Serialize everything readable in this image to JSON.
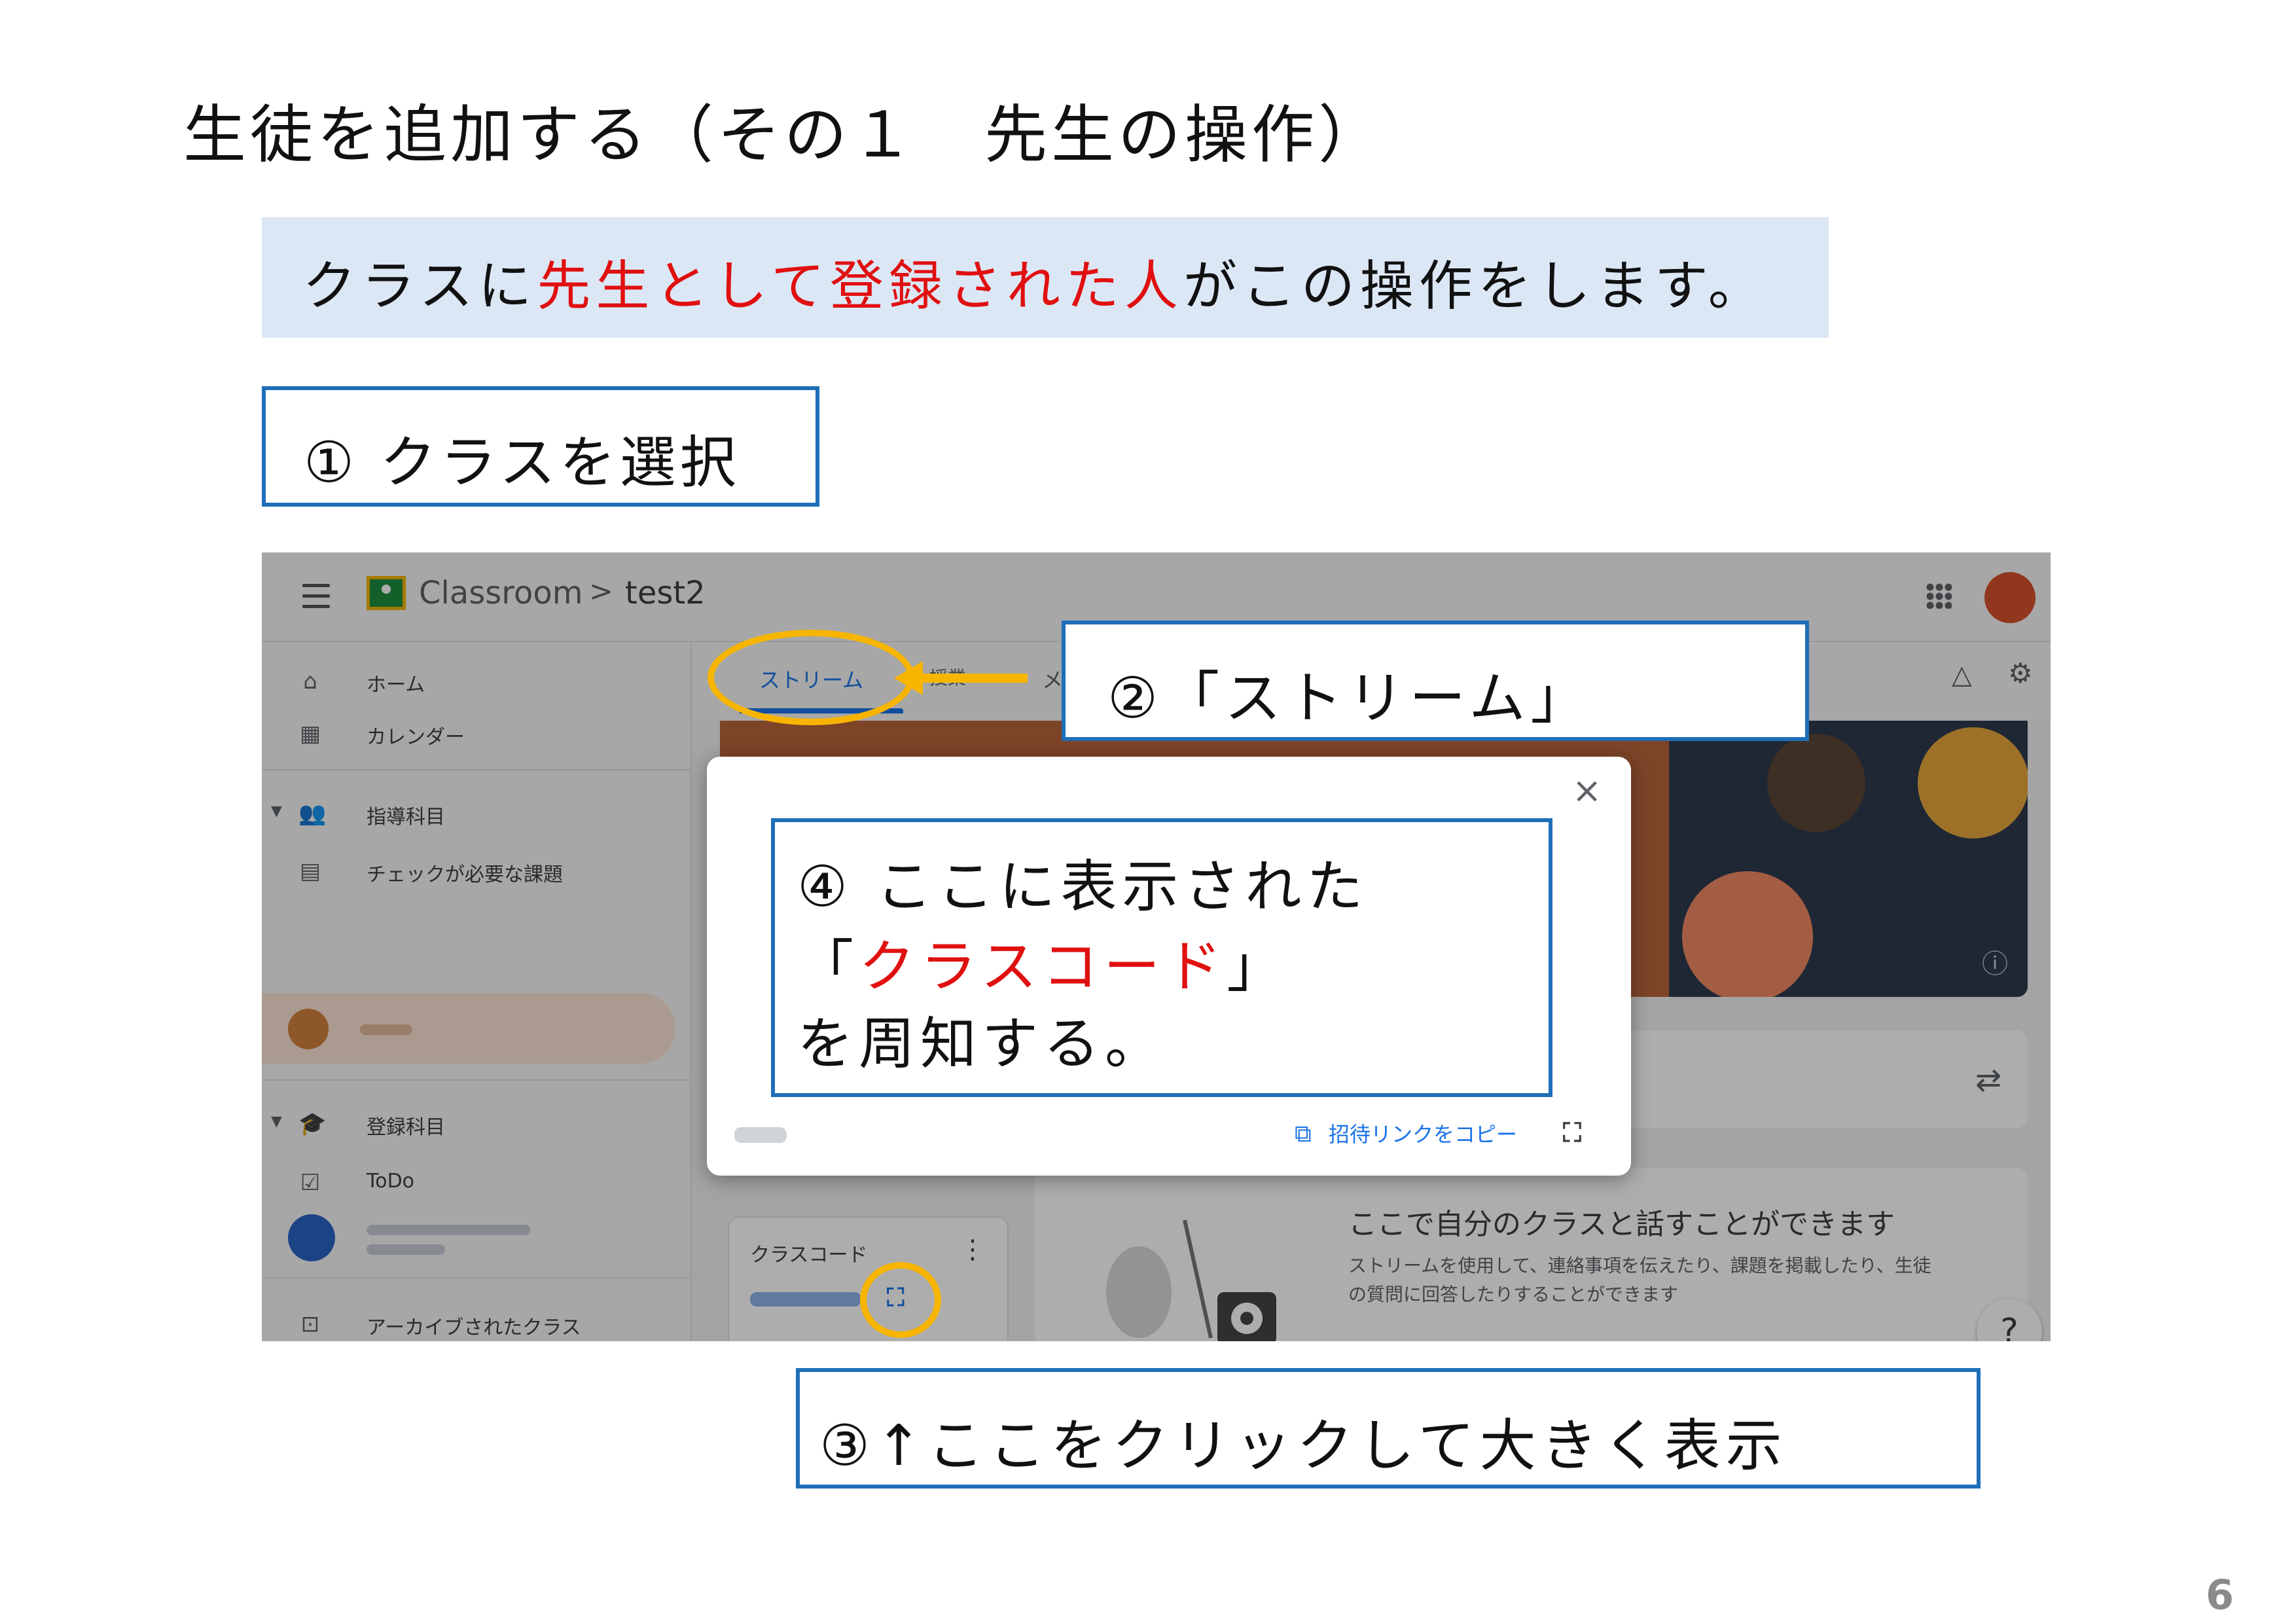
{
  "slide": {
    "title": "生徒を追加する（その１　先生の操作）",
    "banner": {
      "part1": "クラスに",
      "part2_red": "先生として登録された人",
      "part3": "がこの操作をします。"
    },
    "steps": {
      "step1": "① クラスを選択",
      "step2": "②「ストリーム」",
      "step3": "③↑ここをクリックして大きく表示",
      "step4": {
        "line1": "④ ここに表示された",
        "line2_open": "「",
        "line2_red": "クラスコード",
        "line2_close": "」",
        "line3": "を周知する。"
      }
    },
    "page_number": "6",
    "colors": {
      "accent_red": "#e01010",
      "box_border": "#1f6fb8",
      "highlight_ring": "#f7b500",
      "banner_bg": "#dbe7f5"
    }
  },
  "classroom": {
    "topbar": {
      "brand": "Classroom",
      "separator": ">",
      "class_name": "test2",
      "icons": [
        "menu-icon",
        "classroom-logo-icon",
        "apps-grid-icon",
        "account-avatar"
      ]
    },
    "sidebar": {
      "items": [
        {
          "label": "ホーム",
          "icon": "home-icon"
        },
        {
          "label": "カレンダー",
          "icon": "calendar-icon"
        },
        {
          "label": "指導科目",
          "icon": "people-icon"
        },
        {
          "label": "チェックが必要な課題",
          "icon": "folder-icon"
        },
        {
          "label": "登録科目",
          "icon": "school-icon"
        },
        {
          "label": "ToDo",
          "icon": "checklist-icon"
        },
        {
          "label": "アーカイブされたクラス",
          "icon": "archive-icon"
        },
        {
          "label": "設定",
          "icon": "gear-icon"
        }
      ]
    },
    "tabs": {
      "stream": "ストリーム",
      "classwork": "授業",
      "people": "メ"
    },
    "class_code_card": {
      "label": "クラスコード"
    },
    "post_card": {
      "title": "ここで自分のクラスと話すことができます",
      "desc_line1": "ストリームを使用して、連絡事項を伝えたり、課題を掲載したり、生徒",
      "desc_line2": "の質問に回答したりすることができます"
    },
    "dialog": {
      "close": "×",
      "copy_link": "招待リンクをコピー"
    }
  }
}
